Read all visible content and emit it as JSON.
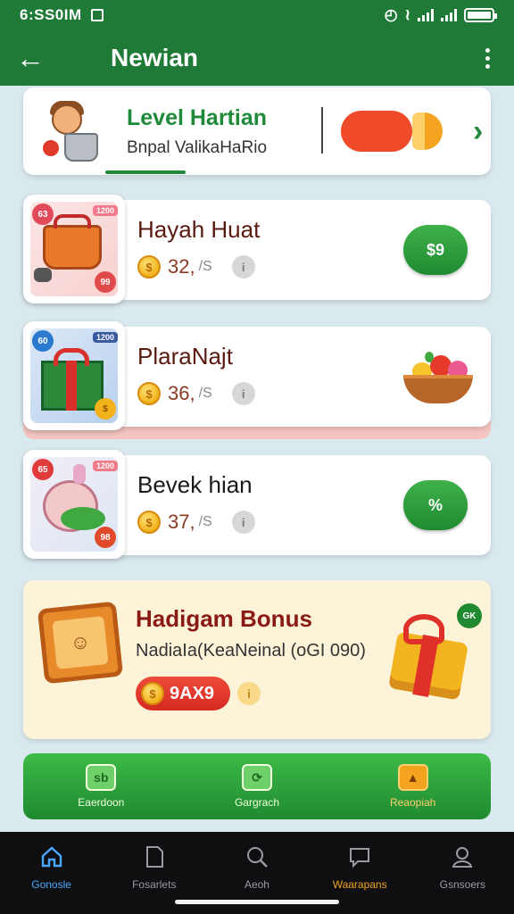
{
  "status_bar": {
    "time": "6:SS0IM"
  },
  "app_bar": {
    "title": "Newian",
    "back_icon": "arrow-left-icon",
    "menu_icon": "more-vertical-icon"
  },
  "level_card": {
    "title": "Level Hartian",
    "subtitle": "Bnpal ValikaHaRio",
    "pill_colors": [
      "#ef4a2a",
      "#f4a321"
    ]
  },
  "items": [
    {
      "name": "Hayah Huat",
      "price": "32,",
      "unit": "/S",
      "badge_tl": "63",
      "badge_tr": "1200",
      "badge_br": "99",
      "action_label": "$9",
      "action_type": "button"
    },
    {
      "name": "PlaraNajt",
      "price": "36,",
      "unit": "/S",
      "badge_tl": "60",
      "badge_tr": "1200",
      "badge_br": "$",
      "action_type": "fruit-bowl"
    },
    {
      "name": "Bevek hian",
      "price": "37,",
      "unit": "/S",
      "badge_tl": "65",
      "badge_tr": "1200",
      "badge_br": "98",
      "action_label": "%",
      "action_type": "button"
    }
  ],
  "bonus": {
    "title": "Hadigam Bonus",
    "subtitle": "NadiaIa(KeaNeinal (oGI 090)",
    "price": "9AX9",
    "badge": "GK"
  },
  "actions": [
    {
      "label": "Eaerdoon",
      "icon": "sb",
      "style": "green"
    },
    {
      "label": "Gargrach",
      "icon": "⟳",
      "style": "green"
    },
    {
      "label": "Reaopiah",
      "icon": "▲",
      "style": "orange"
    }
  ],
  "bottom_nav": [
    {
      "label": "Gonosle",
      "icon": "home-icon",
      "state": "active"
    },
    {
      "label": "Fosarlets",
      "icon": "document-icon",
      "state": "normal"
    },
    {
      "label": "Aeoh",
      "icon": "search-icon",
      "state": "normal"
    },
    {
      "label": "Waarapans",
      "icon": "chat-icon",
      "state": "highlight"
    },
    {
      "label": "Gsnsoers",
      "icon": "profile-icon",
      "state": "normal"
    }
  ],
  "colors": {
    "primary": "#1f7a37",
    "accent_green": "#1f8a3a",
    "accent_orange": "#f4a321",
    "danger": "#ef4a2a",
    "nav_active": "#4aa8ff"
  }
}
